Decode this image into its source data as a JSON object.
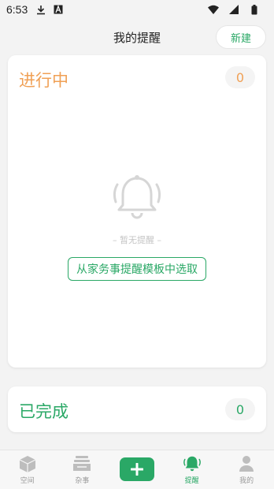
{
  "status_bar": {
    "time": "6:53"
  },
  "header": {
    "title": "我的提醒",
    "new_label": "新建"
  },
  "ongoing": {
    "title": "进行中",
    "count": "0",
    "empty_text": "– 暂无提醒 –",
    "template_button": "从家务事提醒模板中选取"
  },
  "completed": {
    "title": "已完成",
    "count": "0"
  },
  "tabs": [
    {
      "label": "空间",
      "icon": "box-icon"
    },
    {
      "label": "杂事",
      "icon": "tray-icon"
    },
    {
      "label": "",
      "icon": "plus-icon"
    },
    {
      "label": "提醒",
      "icon": "bell-icon",
      "active": true
    },
    {
      "label": "我的",
      "icon": "person-icon"
    }
  ],
  "colors": {
    "accent_green": "#2aa866",
    "accent_orange": "#f0a055"
  }
}
